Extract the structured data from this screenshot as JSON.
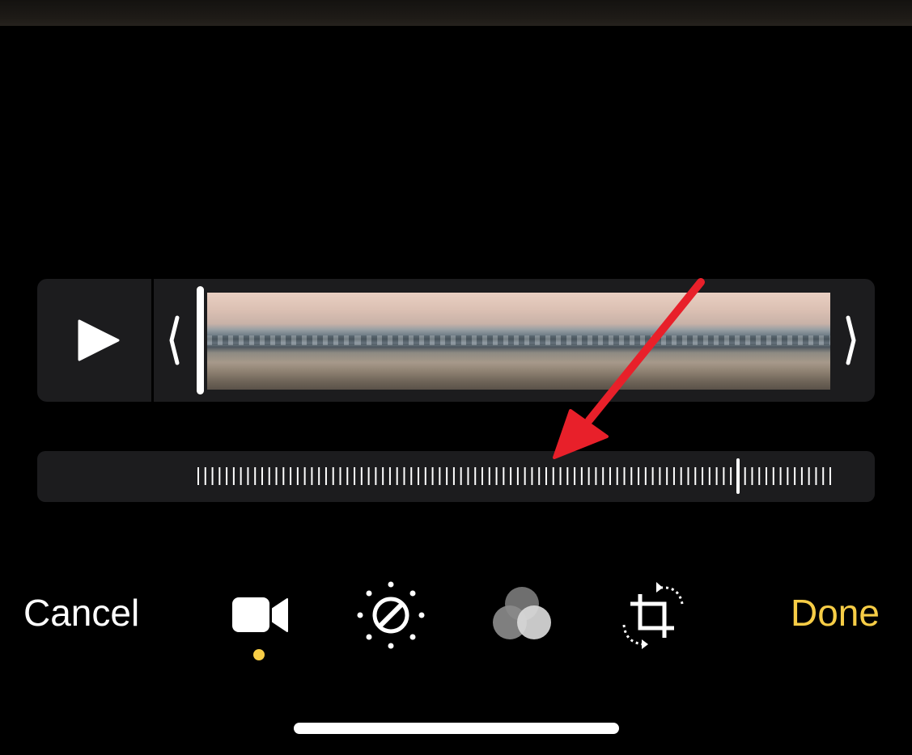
{
  "toolbar": {
    "cancel_label": "Cancel",
    "done_label": "Done",
    "tools": [
      {
        "name": "video",
        "icon": "video-camera-icon",
        "active": true
      },
      {
        "name": "adjust",
        "icon": "adjust-dial-icon",
        "active": false
      },
      {
        "name": "filters",
        "icon": "filters-circles-icon",
        "active": false
      },
      {
        "name": "crop",
        "icon": "crop-rotate-icon",
        "active": false
      }
    ],
    "active_indicator_color": "#f7cd46"
  },
  "trimmer": {
    "play_icon": "play-icon",
    "left_handle_icon": "chevron-left-icon",
    "right_handle_icon": "chevron-right-icon",
    "frame_count": 4,
    "playhead_position": 0
  },
  "scrubber": {
    "tick_count": 90,
    "marker_position": 0.85
  },
  "annotation": {
    "type": "arrow",
    "color": "#e8202a"
  },
  "colors": {
    "background": "#000000",
    "panel": "#1c1c1e",
    "accent": "#f7cd46",
    "text": "#ffffff"
  }
}
